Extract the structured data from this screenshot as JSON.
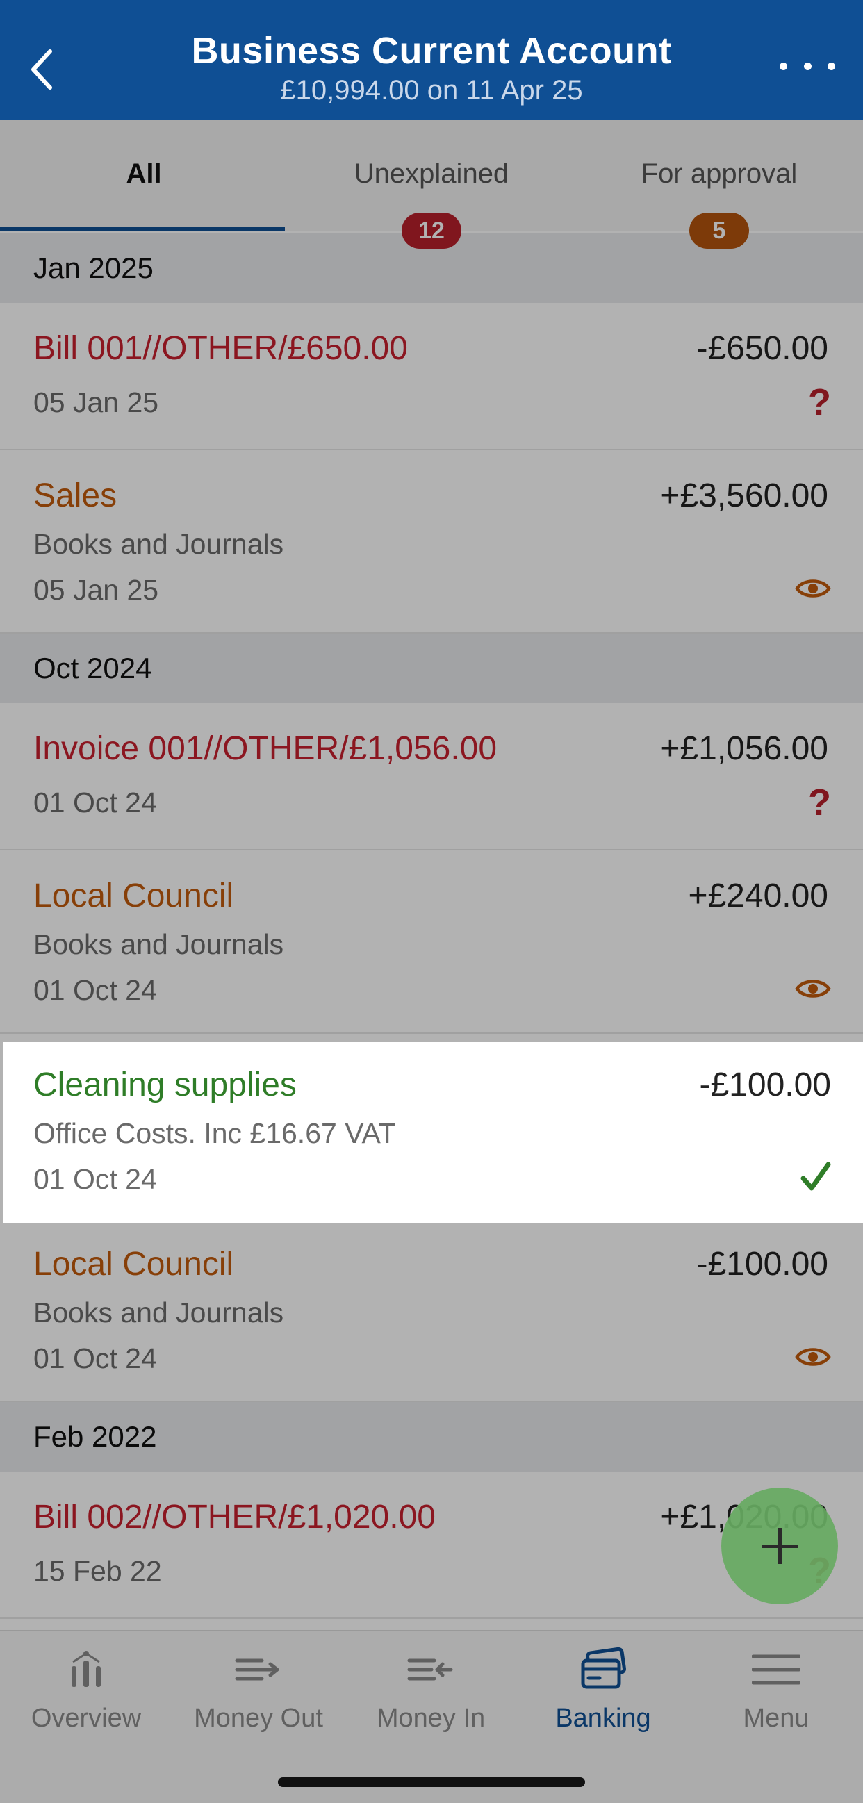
{
  "header": {
    "title": "Business Current Account",
    "subtitle": "£10,994.00 on 11 Apr 25",
    "back_icon": "chevron-left-icon",
    "more_icon": "more-horizontal-icon"
  },
  "tabs": [
    {
      "label": "All",
      "active": true
    },
    {
      "label": "Unexplained",
      "badge": "12",
      "badge_color": "#b8202b"
    },
    {
      "label": "For approval",
      "badge": "5",
      "badge_color": "#b4530d"
    }
  ],
  "sections": [
    {
      "heading": "Jan 2025",
      "rows": [
        {
          "title": "Bill 001//OTHER/£650.00",
          "amount": "-£650.00",
          "date": "05 Jan 25",
          "status": "?"
        },
        {
          "title": "Sales",
          "amount": "+£3,560.00",
          "category": "Books and Journals",
          "date": "05 Jan 25"
        }
      ]
    },
    {
      "heading": "Oct 2024",
      "rows": [
        {
          "title": "Invoice 001//OTHER/£1,056.00",
          "amount": "+£1,056.00",
          "date": "01 Oct 24",
          "status": "?"
        },
        {
          "title": "Local Council",
          "amount": "+£240.00",
          "category": "Books and Journals",
          "date": "01 Oct 24"
        },
        {
          "title": "Cleaning supplies",
          "amount": "-£100.00",
          "category": "Office Costs. Inc £16.67 VAT",
          "date": "01 Oct 24"
        },
        {
          "title": "Local Council",
          "amount": "-£100.00",
          "category": "Books and Journals",
          "date": "01 Oct 24"
        }
      ]
    },
    {
      "heading": "Feb 2022",
      "rows": [
        {
          "title": "Bill 002//OTHER/£1,020.00",
          "amount": "+£1,020.00",
          "date": "15 Feb 22",
          "status": "?"
        }
      ]
    }
  ],
  "status_colors": {
    "unexplained": "#c8202e",
    "for_approval": "#c25b0c",
    "explained": "#2f7d28"
  },
  "fab": {
    "icon": "plus-icon",
    "color": "#67aa62"
  },
  "bottom_nav": [
    {
      "label": "Overview",
      "icon": "bar-chart-icon"
    },
    {
      "label": "Money Out",
      "icon": "money-out-icon"
    },
    {
      "label": "Money In",
      "icon": "money-in-icon"
    },
    {
      "label": "Banking",
      "icon": "bank-card-icon",
      "active": true
    },
    {
      "label": "Menu",
      "icon": "hamburger-menu-icon"
    }
  ]
}
